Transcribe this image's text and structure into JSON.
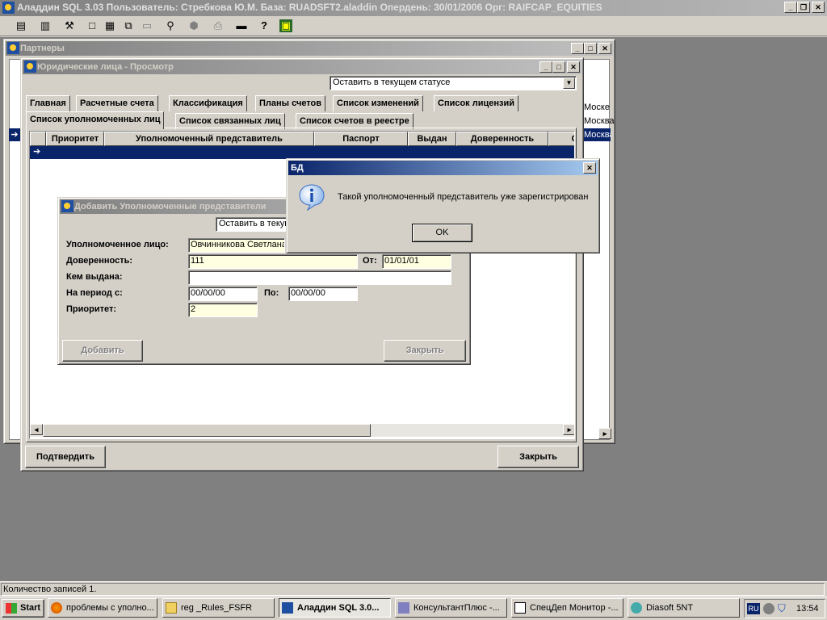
{
  "app": {
    "title": "Аладдин SQL 3.03 Пользователь: Стребкова Ю.М. База: RUADSFT2.aladdin Опердень: 30/01/2006 Орг: RAIFCAP_EQUITIES"
  },
  "partners_window": {
    "title": "Партнеры",
    "city_cells": [
      "Моске",
      "Москва",
      "Москва"
    ]
  },
  "legal_window": {
    "title": "Юридические лица - Просмотр",
    "status_select": "Оставить в текущем статусе",
    "tabs_row1": [
      "Главная",
      "Расчетные счета",
      "Классификация",
      "Планы счетов",
      "Список изменений",
      "Список лицензий"
    ],
    "tabs_row2": [
      "Список уполномоченных лиц",
      "Список связанных лиц",
      "Список счетов в реестре"
    ],
    "grid_headers": [
      "Приоритет",
      "Уполномоченный представитель",
      "Паспорт",
      "Выдан",
      "Доверенность",
      "О"
    ],
    "confirm_button": "Подтвердить",
    "close_button": "Закрыть"
  },
  "add_dialog": {
    "title": "Добавить Уполномоченные представители",
    "status_select": "Оставить в текущ",
    "labels": {
      "person": "Уполномоченное лицо:",
      "proxy": "Доверенность:",
      "from": "От:",
      "issued_by": "Кем выдана:",
      "period_from": "На период с:",
      "period_to": "По:",
      "priority": "Приоритет:"
    },
    "values": {
      "person": "Овчинникова Светлана",
      "proxy": "111",
      "from": "01/01/01",
      "issued_by": "",
      "period_from": "00/00/00",
      "period_to": "00/00/00",
      "priority": "2"
    },
    "add_button": "Добавить",
    "close_button": "Закрыть"
  },
  "message_box": {
    "title": "БД",
    "message": "Такой уполномоченный представитель уже зарегистрирован",
    "ok_button": "OK"
  },
  "status_bar": {
    "text": "Количество записей 1."
  },
  "taskbar": {
    "start": "Start",
    "items": [
      {
        "label": "проблемы с уполно..."
      },
      {
        "label": "reg _Rules_FSFR"
      },
      {
        "label": "Аладдин SQL 3.0..."
      },
      {
        "label": "КонсультантПлюс -..."
      },
      {
        "label": "СпецДеп Монитор -..."
      },
      {
        "label": "Diasoft 5NT"
      }
    ],
    "lang": "RU",
    "clock": "13:54"
  }
}
